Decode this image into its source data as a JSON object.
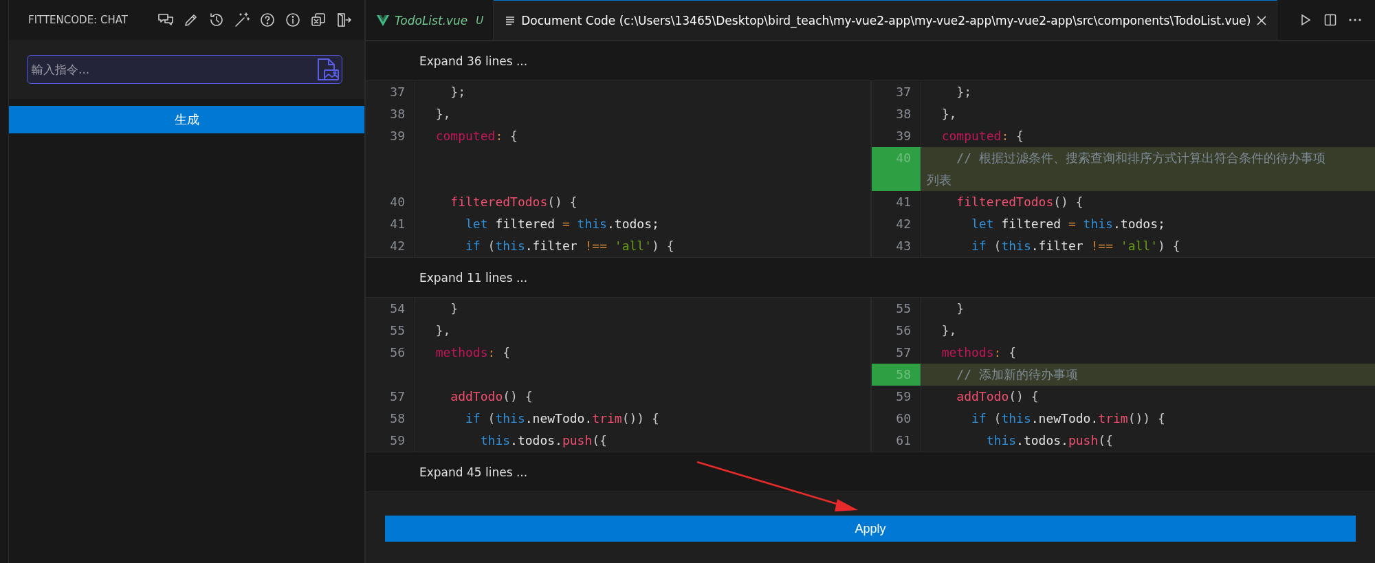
{
  "sidebar": {
    "title": "FITTENCODE: CHAT",
    "input": {
      "placeholder": "輸入指令..."
    },
    "generate_button": "生成"
  },
  "tabs": [
    {
      "label": "TodoList.vue",
      "status": "U",
      "selected": false,
      "kind": "vue"
    },
    {
      "label": "Document Code (c:\\Users\\13465\\Desktop\\bird_teach\\my-vue2-app\\my-vue2-app\\my-vue2-app\\src\\components\\TodoList.vue)",
      "selected": true,
      "kind": "document"
    }
  ],
  "diff": {
    "sections": [
      {
        "expand": "Expand 36 lines ...",
        "rows": [
          {
            "left": {
              "kind": "line",
              "num": "37",
              "tokens": [
                {
                  "t": "    };",
                  "color": "#c8c8c8"
                }
              ]
            },
            "right": {
              "num": "37",
              "added": false,
              "tokens": [
                {
                  "t": "    };",
                  "color": "#c8c8c8"
                }
              ]
            }
          },
          {
            "left": {
              "kind": "line",
              "num": "38",
              "tokens": [
                {
                  "t": "  },",
                  "color": "#c8c8c8"
                }
              ]
            },
            "right": {
              "num": "38",
              "added": false,
              "tokens": [
                {
                  "t": "  },",
                  "color": "#c8c8c8"
                }
              ]
            }
          },
          {
            "left": {
              "kind": "line",
              "num": "39",
              "tokens": [
                {
                  "t": "  computed",
                  "color": "#c2185b"
                },
                {
                  "t": ":",
                  "color": "#c8843a"
                },
                {
                  "t": " {",
                  "color": "#c8c8c8"
                }
              ]
            },
            "right": {
              "num": "39",
              "added": false,
              "tokens": [
                {
                  "t": "  computed",
                  "color": "#c2185b"
                },
                {
                  "t": ":",
                  "color": "#c8843a"
                },
                {
                  "t": " {",
                  "color": "#c8c8c8"
                }
              ]
            }
          },
          {
            "left": {
              "kind": "filler"
            },
            "right": {
              "num": "40",
              "added": true,
              "tokens": [
                {
                  "t": "    // 根据过滤条件、搜索查询和排序方式计算出符合条件的待办事项列表",
                  "color": "#7e8a96"
                }
              ]
            }
          },
          {
            "left": {
              "kind": "line",
              "num": "40",
              "tokens": [
                {
                  "t": "    filteredTodos",
                  "color": "#f0506e"
                },
                {
                  "t": "() {",
                  "color": "#c8c8c8"
                }
              ]
            },
            "right": {
              "num": "41",
              "added": false,
              "tokens": [
                {
                  "t": "    filteredTodos",
                  "color": "#f0506e"
                },
                {
                  "t": "() {",
                  "color": "#c8c8c8"
                }
              ]
            }
          },
          {
            "left": {
              "kind": "line",
              "num": "41",
              "tokens": [
                {
                  "t": "      let",
                  "color": "#2f8fd8"
                },
                {
                  "t": " filtered ",
                  "color": "#e4e4e4"
                },
                {
                  "t": "=",
                  "color": "#c8843a"
                },
                {
                  "t": " this",
                  "color": "#2f8fd8"
                },
                {
                  "t": ".todos;",
                  "color": "#e4e4e4"
                }
              ]
            },
            "right": {
              "num": "42",
              "added": false,
              "tokens": [
                {
                  "t": "      let",
                  "color": "#2f8fd8"
                },
                {
                  "t": " filtered ",
                  "color": "#e4e4e4"
                },
                {
                  "t": "=",
                  "color": "#c8843a"
                },
                {
                  "t": " this",
                  "color": "#2f8fd8"
                },
                {
                  "t": ".todos;",
                  "color": "#e4e4e4"
                }
              ]
            }
          },
          {
            "left": {
              "kind": "line",
              "num": "42",
              "tokens": [
                {
                  "t": "      if",
                  "color": "#2f8fd8"
                },
                {
                  "t": " (",
                  "color": "#c8c8c8"
                },
                {
                  "t": "this",
                  "color": "#2f8fd8"
                },
                {
                  "t": ".filter ",
                  "color": "#e4e4e4"
                },
                {
                  "t": "!==",
                  "color": "#c8843a"
                },
                {
                  "t": " 'all'",
                  "color": "#6a9a1a"
                },
                {
                  "t": ") {",
                  "color": "#c8c8c8"
                }
              ]
            },
            "right": {
              "num": "43",
              "added": false,
              "tokens": [
                {
                  "t": "      if",
                  "color": "#2f8fd8"
                },
                {
                  "t": " (",
                  "color": "#c8c8c8"
                },
                {
                  "t": "this",
                  "color": "#2f8fd8"
                },
                {
                  "t": ".filter ",
                  "color": "#e4e4e4"
                },
                {
                  "t": "!==",
                  "color": "#c8843a"
                },
                {
                  "t": " 'all'",
                  "color": "#6a9a1a"
                },
                {
                  "t": ") {",
                  "color": "#c8c8c8"
                }
              ]
            }
          }
        ]
      },
      {
        "expand": "Expand 11 lines ...",
        "rows": [
          {
            "left": {
              "kind": "line",
              "num": "54",
              "tokens": [
                {
                  "t": "    }",
                  "color": "#c8c8c8"
                }
              ]
            },
            "right": {
              "num": "55",
              "added": false,
              "tokens": [
                {
                  "t": "    }",
                  "color": "#c8c8c8"
                }
              ]
            }
          },
          {
            "left": {
              "kind": "line",
              "num": "55",
              "tokens": [
                {
                  "t": "  },",
                  "color": "#c8c8c8"
                }
              ]
            },
            "right": {
              "num": "56",
              "added": false,
              "tokens": [
                {
                  "t": "  },",
                  "color": "#c8c8c8"
                }
              ]
            }
          },
          {
            "left": {
              "kind": "line",
              "num": "56",
              "tokens": [
                {
                  "t": "  methods",
                  "color": "#c2185b"
                },
                {
                  "t": ":",
                  "color": "#c8843a"
                },
                {
                  "t": " {",
                  "color": "#c8c8c8"
                }
              ]
            },
            "right": {
              "num": "57",
              "added": false,
              "tokens": [
                {
                  "t": "  methods",
                  "color": "#c2185b"
                },
                {
                  "t": ":",
                  "color": "#c8843a"
                },
                {
                  "t": " {",
                  "color": "#c8c8c8"
                }
              ]
            }
          },
          {
            "left": {
              "kind": "filler"
            },
            "right": {
              "num": "58",
              "added": true,
              "tokens": [
                {
                  "t": "    // 添加新的待办事项",
                  "color": "#7e8a96"
                }
              ]
            }
          },
          {
            "left": {
              "kind": "line",
              "num": "57",
              "tokens": [
                {
                  "t": "    addTodo",
                  "color": "#f0506e"
                },
                {
                  "t": "() {",
                  "color": "#c8c8c8"
                }
              ]
            },
            "right": {
              "num": "59",
              "added": false,
              "tokens": [
                {
                  "t": "    addTodo",
                  "color": "#f0506e"
                },
                {
                  "t": "() {",
                  "color": "#c8c8c8"
                }
              ]
            }
          },
          {
            "left": {
              "kind": "line",
              "num": "58",
              "tokens": [
                {
                  "t": "      if",
                  "color": "#2f8fd8"
                },
                {
                  "t": " (",
                  "color": "#c8c8c8"
                },
                {
                  "t": "this",
                  "color": "#2f8fd8"
                },
                {
                  "t": ".newTodo.",
                  "color": "#e4e4e4"
                },
                {
                  "t": "trim",
                  "color": "#f0506e"
                },
                {
                  "t": "()) {",
                  "color": "#c8c8c8"
                }
              ]
            },
            "right": {
              "num": "60",
              "added": false,
              "tokens": [
                {
                  "t": "      if",
                  "color": "#2f8fd8"
                },
                {
                  "t": " (",
                  "color": "#c8c8c8"
                },
                {
                  "t": "this",
                  "color": "#2f8fd8"
                },
                {
                  "t": ".newTodo.",
                  "color": "#e4e4e4"
                },
                {
                  "t": "trim",
                  "color": "#f0506e"
                },
                {
                  "t": "()) {",
                  "color": "#c8c8c8"
                }
              ]
            }
          },
          {
            "left": {
              "kind": "line",
              "num": "59",
              "tokens": [
                {
                  "t": "        this",
                  "color": "#2f8fd8"
                },
                {
                  "t": ".todos.",
                  "color": "#e4e4e4"
                },
                {
                  "t": "push",
                  "color": "#f0506e"
                },
                {
                  "t": "({",
                  "color": "#c8c8c8"
                }
              ]
            },
            "right": {
              "num": "61",
              "added": false,
              "tokens": [
                {
                  "t": "        this",
                  "color": "#2f8fd8"
                },
                {
                  "t": ".todos.",
                  "color": "#e4e4e4"
                },
                {
                  "t": "push",
                  "color": "#f0506e"
                },
                {
                  "t": "({",
                  "color": "#c8c8c8"
                }
              ]
            }
          }
        ]
      },
      {
        "expand": "Expand 45 lines ..."
      }
    ]
  },
  "apply_button": "Apply"
}
